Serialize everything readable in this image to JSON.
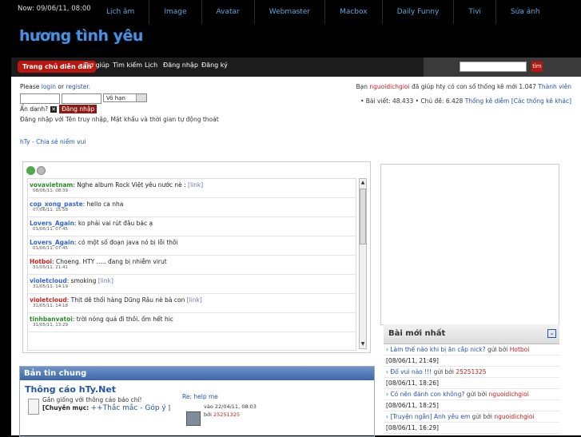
{
  "topbar": {
    "now": "Now: 09/06/11, 08:00",
    "nav": [
      "Lịch âm",
      "Image",
      "Avatar",
      "Webmaster",
      "Macbox",
      "Daily Funny",
      "Tivi",
      "Sửa ảnh"
    ]
  },
  "logo": "hương tình yêu",
  "menu": {
    "home": "Trang chủ diễn đàn",
    "items": [
      "Trợ giúp",
      "Tìm kiếm",
      "Lịch",
      "Đăng nhập",
      "Đăng ký"
    ],
    "search_button": "tìm"
  },
  "login": {
    "prompt_please": "Please",
    "login_link": "login",
    "or": "or",
    "register_link": "register.",
    "duration": "Vô hạn",
    "anon_label": "Ẩn danh?",
    "login_button": "Đăng nhập",
    "note": "Đăng nhập với Tên truy nhập, Mật khẩu và thời gian tự động thoát"
  },
  "slogan": "hTy - Chia sẻ niềm vui",
  "stats": {
    "line1_pre": "Bạn",
    "line1_user": "nguoidichgioi",
    "line1_post": "đã giúp hty có con số thống kê mới 1.047",
    "line1_link": "Thành viên",
    "line2_text": "• Bài viết: 48.433  • Chủ đề: 6.428",
    "line2_link": "Thống kê diễm [Các thống kê khác]"
  },
  "shoutbox": {
    "messages": [
      {
        "user": "vovavietnam",
        "color": "#2a8a2a",
        "text": "Nghe album Rock Việt yêu nước nè :",
        "link": "[link]",
        "time": "08/06/11, 08:39"
      },
      {
        "user": "cop_xong_paste",
        "color": "#3366cc",
        "text": "hello ca nha",
        "link": "",
        "time": "07/06/11, 15:58"
      },
      {
        "user": "Lovers_Again",
        "color": "#3366cc",
        "text": "ko phải vai rút đâu bác ạ",
        "link": "",
        "time": "01/06/11, 07:45"
      },
      {
        "user": "Lovers_Again",
        "color": "#3366cc",
        "text": "có một số đoạn java nó bị lỗi thôi",
        "link": "",
        "time": "01/06/11, 07:45"
      },
      {
        "user": "Hotboi",
        "color": "#cc2222",
        "text": "Choeng. HTY ..... đang bị nhiễm virut",
        "link": "",
        "time": "31/05/11, 21:41"
      },
      {
        "user": "violetcloud",
        "color": "#3366cc",
        "text": "smoking",
        "link": "[link]",
        "time": "31/05/11, 14:19"
      },
      {
        "user": "violetcloud",
        "color": "#cc2222",
        "text": "Thịt dê thối hàng Dũng Râu nè bà con",
        "link": "[link]",
        "time": "31/05/11, 14:18"
      },
      {
        "user": "tinhbanvatoi",
        "color": "#2a8a2a",
        "text": "trời nóng quá đi thôi. ốm hết hic",
        "link": "",
        "time": "31/05/11, 13:29"
      }
    ]
  },
  "news": {
    "header": "Bản tin chung",
    "title": "Thông cáo hTy.Net",
    "desc": "Gần giống với thông cáo báo chí!",
    "category_label": "[Chuyên mục:",
    "category_link": "++Thắc mắc - Góp ý",
    "category_end": "]",
    "reply_link": "Re: help me",
    "reply_date": "vào 22/04/11, 08:03",
    "reply_by_label": "bởi",
    "reply_by": "25251325"
  },
  "latest": {
    "header": "Bài mới nhất",
    "collapse_icon": "collapse-icon",
    "items": [
      {
        "title": "› Làm thế nào khi bị ăn cắp nick?",
        "by_label": "gửi bởi",
        "by": "Hotboi",
        "date": "[08/06/11, 21:49]"
      },
      {
        "title": "› Đố vui nào !!!",
        "by_label": "gửi bởi",
        "by": "25251325",
        "date": "[08/06/11, 18:26]"
      },
      {
        "title": "› Có nên đánh con không?",
        "by_label": "gửi bởi",
        "by": "nguoidichgioi",
        "date": "[08/06/11, 18:25]"
      },
      {
        "title": "› [Truyện ngắn] Anh yêu em",
        "by_label": "gửi bởi",
        "by": "nguoidichgioi",
        "date": "[08/06/11, 16:29]"
      }
    ]
  }
}
